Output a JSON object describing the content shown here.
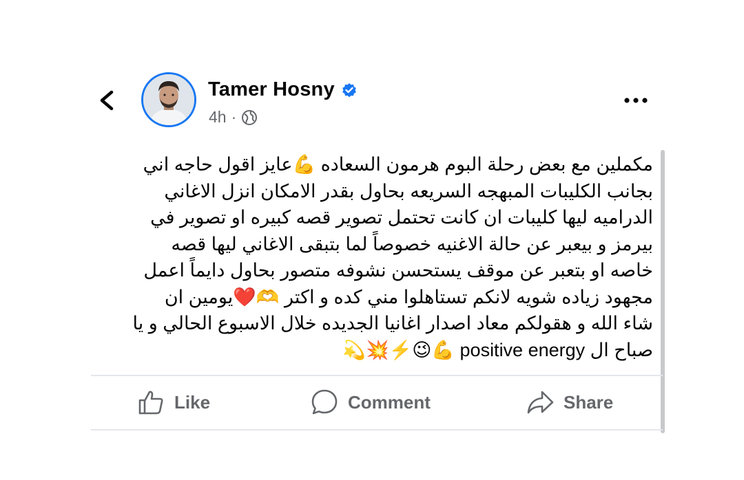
{
  "post": {
    "author": "Tamer Hosny",
    "time": "4h",
    "separator": "·",
    "text": "مكملين مع بعض رحلة البوم هرمون السعاده 💪عايز اقول حاجه  اني\nبجانب الكليبات المبهجه السريعه بحاول بقدر الامكان انزل الاغاني\nالدراميه ليها كليبات ان كانت تحتمل تصوير قصه كبيره او تصوير في\nبيرمز و بيعبر عن حالة الاغنيه خصوصاً لما بتبقى الاغاني ليها قصه\nخاصه او بتعبر عن موقف يستحسن نشوفه متصور  بحاول دايماً اعمل\nمجهود زياده شويه لانكم تستاهلوا مني كده و اكتر  🫶❤️يومين ان\nشاء الله و هقولكم معاد اصدار اغانيا الجديده خلال الاسبوع الحالي  و يا\nصباح ال positive energy 💪😉⚡️💥💫"
  },
  "actions": {
    "like": "Like",
    "comment": "Comment",
    "share": "Share"
  },
  "icons": {
    "back": "chevron-left-icon",
    "more": "more-dots-icon",
    "verified": "verified-badge-icon",
    "audience": "globe-icon",
    "like": "thumbs-up-icon",
    "comment": "speech-bubble-icon",
    "share": "share-arrow-icon"
  },
  "colors": {
    "accent": "#1877f2",
    "secondary_text": "#65676b",
    "divider": "#e4e6eb"
  }
}
